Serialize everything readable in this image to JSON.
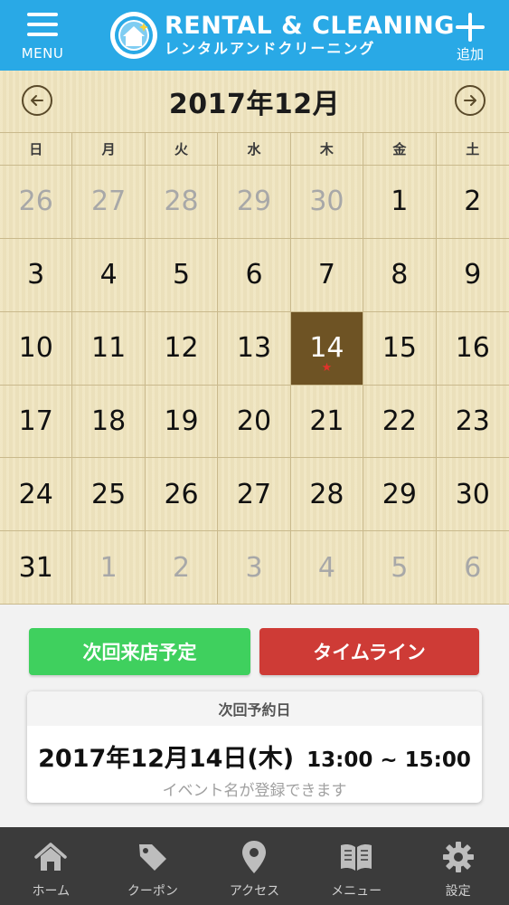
{
  "header": {
    "menu_label": "MENU",
    "add_label": "追加",
    "logo_title": "RENTAL & CLEANING",
    "logo_subtitle": "レンタルアンドクリーニング",
    "color": "#29a9e6"
  },
  "calendar": {
    "month_title": "2017年12月",
    "weekdays": [
      "日",
      "月",
      "火",
      "水",
      "木",
      "金",
      "土"
    ],
    "weeks": [
      [
        "26",
        "27",
        "28",
        "29",
        "30",
        "1",
        "2"
      ],
      [
        "3",
        "4",
        "5",
        "6",
        "7",
        "8",
        "9"
      ],
      [
        "10",
        "11",
        "12",
        "13",
        "14",
        "15",
        "16"
      ],
      [
        "17",
        "18",
        "19",
        "20",
        "21",
        "22",
        "23"
      ],
      [
        "24",
        "25",
        "26",
        "27",
        "28",
        "29",
        "30"
      ],
      [
        "31",
        "1",
        "2",
        "3",
        "4",
        "5",
        "6"
      ]
    ],
    "muted_days": [
      "0-0",
      "0-1",
      "0-2",
      "0-3",
      "0-4",
      "5-1",
      "5-2",
      "5-3",
      "5-4",
      "5-5",
      "5-6"
    ],
    "selected_day": "2-4",
    "selected_marker": "★",
    "selected_color": "#6e5324"
  },
  "actions": {
    "next_visit_label": "次回来店予定",
    "timeline_label": "タイムライン",
    "next_visit_color": "#3fd05e",
    "timeline_color": "#ce3b36"
  },
  "reservation": {
    "heading": "次回予約日",
    "date": "2017年12月14日(木)",
    "time": "13:00 ~ 15:00",
    "note": "イベント名が登録できます"
  },
  "tabbar": {
    "items": [
      {
        "label": "ホーム",
        "icon": "home-icon"
      },
      {
        "label": "クーポン",
        "icon": "tag-icon"
      },
      {
        "label": "アクセス",
        "icon": "map-pin-icon"
      },
      {
        "label": "メニュー",
        "icon": "book-icon"
      },
      {
        "label": "設定",
        "icon": "gear-icon"
      }
    ]
  }
}
